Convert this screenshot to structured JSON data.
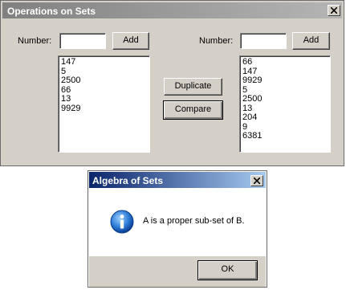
{
  "main_window": {
    "title": "Operations on Sets",
    "left_panel": {
      "number_label": "Number:",
      "number_value": "",
      "add_label": "Add",
      "items": [
        "147",
        "5",
        "2500",
        "66",
        "13",
        "9929"
      ]
    },
    "right_panel": {
      "number_label": "Number:",
      "number_value": "",
      "add_label": "Add",
      "items": [
        "66",
        "147",
        "9929",
        "5",
        "2500",
        "13",
        "204",
        "9",
        "6381"
      ]
    },
    "duplicate_label": "Duplicate",
    "compare_label": "Compare"
  },
  "dialog": {
    "title": "Algebra of Sets",
    "message": "A is a proper sub-set of B.",
    "ok_label": "OK",
    "icon": "information-icon"
  },
  "colors": {
    "inactive_title": "#808080",
    "active_title": "#0a246a",
    "face": "#d4d0c8"
  }
}
